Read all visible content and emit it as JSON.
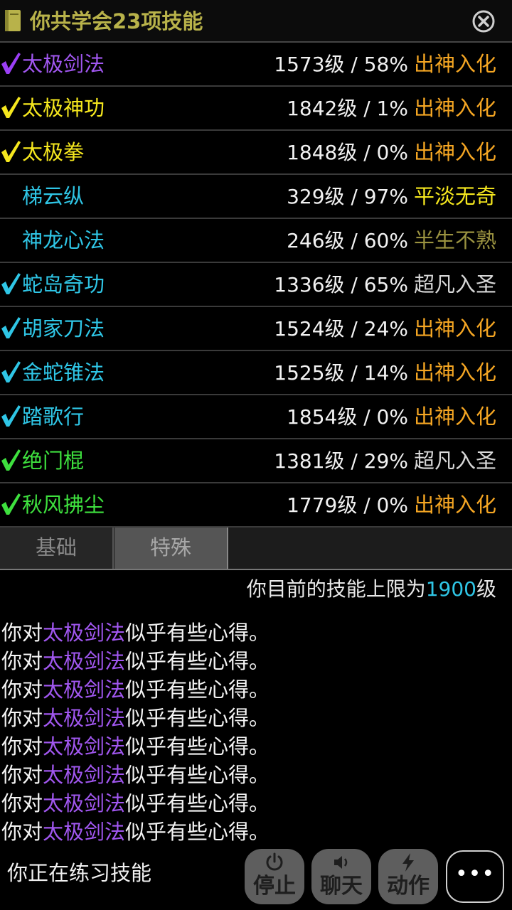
{
  "header": {
    "title": "你共学会23项技能",
    "book_icon": "book-icon",
    "close_icon": "close-circle-icon"
  },
  "skills": [
    {
      "name": "太极剑法",
      "level": "1573级 / 58%",
      "grade": "出神入化",
      "checked": true,
      "check_color": "#9b3ff5",
      "name_color": "#a157f0",
      "grade_color": "#f5a623"
    },
    {
      "name": "太极神功",
      "level": "1842级 / 1%",
      "grade": "出神入化",
      "checked": true,
      "check_color": "#f5e71e",
      "name_color": "#f5e71e",
      "grade_color": "#f5a623"
    },
    {
      "name": "太极拳",
      "level": "1848级 / 0%",
      "grade": "出神入化",
      "checked": true,
      "check_color": "#f5e71e",
      "name_color": "#f5e71e",
      "grade_color": "#f5a623"
    },
    {
      "name": "梯云纵",
      "level": "329级 / 97%",
      "grade": "平淡无奇",
      "checked": false,
      "check_color": "",
      "name_color": "#2fc6e6",
      "grade_color": "#f5e71e"
    },
    {
      "name": "神龙心法",
      "level": "246级 / 60%",
      "grade": "半生不熟",
      "checked": false,
      "check_color": "",
      "name_color": "#2fc6e6",
      "grade_color": "#9a9240"
    },
    {
      "name": "蛇岛奇功",
      "level": "1336级 / 65%",
      "grade": "超凡入圣",
      "checked": true,
      "check_color": "#2fc6e6",
      "name_color": "#2fc6e6",
      "grade_color": "#d8d8d8"
    },
    {
      "name": "胡家刀法",
      "level": "1524级 / 24%",
      "grade": "出神入化",
      "checked": true,
      "check_color": "#2fc6e6",
      "name_color": "#2fc6e6",
      "grade_color": "#f5a623"
    },
    {
      "name": "金蛇锥法",
      "level": "1525级 / 14%",
      "grade": "出神入化",
      "checked": true,
      "check_color": "#2fc6e6",
      "name_color": "#2fc6e6",
      "grade_color": "#f5a623"
    },
    {
      "name": "踏歌行",
      "level": "1854级 / 0%",
      "grade": "出神入化",
      "checked": true,
      "check_color": "#2fc6e6",
      "name_color": "#2fc6e6",
      "grade_color": "#f5a623"
    },
    {
      "name": "绝门棍",
      "level": "1381级 / 29%",
      "grade": "超凡入圣",
      "checked": true,
      "check_color": "#3ee03e",
      "name_color": "#3ee03e",
      "grade_color": "#d8d8d8"
    },
    {
      "name": "秋风拂尘",
      "level": "1779级 / 0%",
      "grade": "出神入化",
      "checked": true,
      "check_color": "#3ee03e",
      "name_color": "#3ee03e",
      "grade_color": "#f5a623"
    }
  ],
  "tabs": [
    {
      "label": "基础"
    },
    {
      "label": "特殊"
    }
  ],
  "skill_limit": {
    "prefix": "你目前的技能上限为",
    "value": "1900",
    "suffix": "级"
  },
  "messages": [
    {
      "prefix": "你对",
      "skill": "太极剑法",
      "suffix": "似乎有些心得。"
    },
    {
      "prefix": "你对",
      "skill": "太极剑法",
      "suffix": "似乎有些心得。"
    },
    {
      "prefix": "你对",
      "skill": "太极剑法",
      "suffix": "似乎有些心得。"
    },
    {
      "prefix": "你对",
      "skill": "太极剑法",
      "suffix": "似乎有些心得。"
    },
    {
      "prefix": "你对",
      "skill": "太极剑法",
      "suffix": "似乎有些心得。"
    },
    {
      "prefix": "你对",
      "skill": "太极剑法",
      "suffix": "似乎有些心得。"
    },
    {
      "prefix": "你对",
      "skill": "太极剑法",
      "suffix": "似乎有些心得。"
    },
    {
      "prefix": "你对",
      "skill": "太极剑法",
      "suffix": "似乎有些心得。"
    }
  ],
  "status": {
    "text": "你正在练习技能"
  },
  "actions": [
    {
      "label": "停止",
      "icon": "power-icon"
    },
    {
      "label": "聊天",
      "icon": "speaker-icon"
    },
    {
      "label": "动作",
      "icon": "lightning-icon"
    }
  ],
  "more_button": {
    "label": "•••",
    "icon": "more-dots-icon"
  }
}
